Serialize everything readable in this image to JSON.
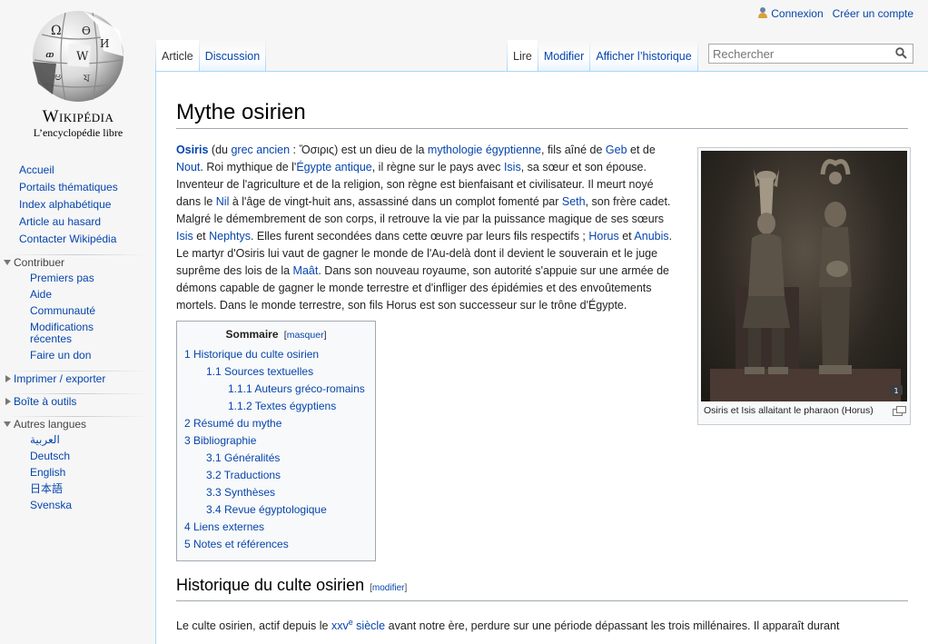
{
  "personal": {
    "login": "Connexion",
    "create_account": "Créer un compte"
  },
  "logo": {
    "wordmark": "Wikipédia",
    "tagline": "L’encyclopédie libre"
  },
  "sidebar": {
    "nav": [
      "Accueil",
      "Portails thématiques",
      "Index alphabétique",
      "Article au hasard",
      "Contacter Wikipédia"
    ],
    "contribuer": {
      "title": "Contribuer",
      "items": [
        "Premiers pas",
        "Aide",
        "Communauté",
        "Modifications récentes",
        "Faire un don"
      ]
    },
    "print": {
      "title": "Imprimer / exporter"
    },
    "tools": {
      "title": "Boîte à outils"
    },
    "langs": {
      "title": "Autres langues",
      "items": [
        "العربية",
        "Deutsch",
        "English",
        "日本語",
        "Svenska"
      ]
    }
  },
  "tabs": {
    "article": "Article",
    "discussion": "Discussion",
    "read": "Lire",
    "edit": "Modifier",
    "history": "Afficher l’historique"
  },
  "search": {
    "placeholder": "Rechercher"
  },
  "article": {
    "title": "Mythe osirien",
    "intro": {
      "t1": "Osiris",
      "t2": " (du ",
      "t3": "grec ancien",
      "t4": " : Ὄσιρις) est un dieu de la ",
      "t5": "mythologie égyptienne",
      "t6": ", fils aîné de ",
      "t7": "Geb",
      "t8": " et de ",
      "t9": "Nout",
      "t10": ". Roi mythique de l'",
      "t11": "Égypte antique",
      "t12": ", il règne sur le pays avec ",
      "t13": "Isis",
      "t14": ", sa sœur et son épouse. Inventeur de l'agriculture et de la religion, son règne est bienfaisant et civilisateur. Il meurt noyé dans le ",
      "t15": "Nil",
      "t16": " à l'âge de vingt-huit ans, assassiné dans un complot fomenté par ",
      "t17": "Seth",
      "t18": ", son frère cadet. Malgré le démembrement de son corps, il retrouve la vie par la puissance magique de ses sœurs ",
      "t19": "Isis",
      "t20": " et ",
      "t21": "Nephtys",
      "t22": ". Elles furent secondées dans cette œuvre par leurs fils respectifs ; ",
      "t23": "Horus",
      "t24": " et ",
      "t25": "Anubis",
      "t26": ". Le martyr d'Osiris lui vaut de gagner le monde de l'Au-delà dont il devient le souverain et le juge suprême des lois de la ",
      "t27": "Maât",
      "t28": ". Dans son nouveau royaume, son autorité s'appuie sur une armée de démons capable de gagner le monde terrestre et d'infliger des épidémies et des envoûtements mortels. Dans le monde terrestre, son fils Horus est son successeur sur le trône d'Égypte."
    },
    "image_caption": "Osiris et Isis allaitant le pharaon (Horus)",
    "image_badge": "1",
    "toc": {
      "title": "Sommaire",
      "toggle": "masquer",
      "items": [
        {
          "level": 1,
          "text": "1 Historique du culte osirien"
        },
        {
          "level": 2,
          "text": "1.1 Sources textuelles"
        },
        {
          "level": 3,
          "text": "1.1.1 Auteurs gréco-romains"
        },
        {
          "level": 3,
          "text": "1.1.2 Textes égyptiens"
        },
        {
          "level": 1,
          "text": "2 Résumé du mythe"
        },
        {
          "level": 1,
          "text": "3 Bibliographie"
        },
        {
          "level": 2,
          "text": "3.1 Généralités"
        },
        {
          "level": 2,
          "text": "3.2 Traductions"
        },
        {
          "level": 2,
          "text": "3.3 Synthèses"
        },
        {
          "level": 2,
          "text": "3.4 Revue égyptologique"
        },
        {
          "level": 1,
          "text": "4 Liens externes"
        },
        {
          "level": 1,
          "text": "5 Notes et références"
        }
      ]
    },
    "section1": {
      "title": "Historique du culte osirien",
      "edit": "modifier"
    },
    "section1_text": {
      "a": "Le culte osirien, actif depuis le ",
      "link": "xxv",
      "sup": "e",
      "link2": " siècle",
      "b": " avant notre ère, perdure sur une période dépassant les trois millénaires. Il apparaît durant"
    }
  }
}
